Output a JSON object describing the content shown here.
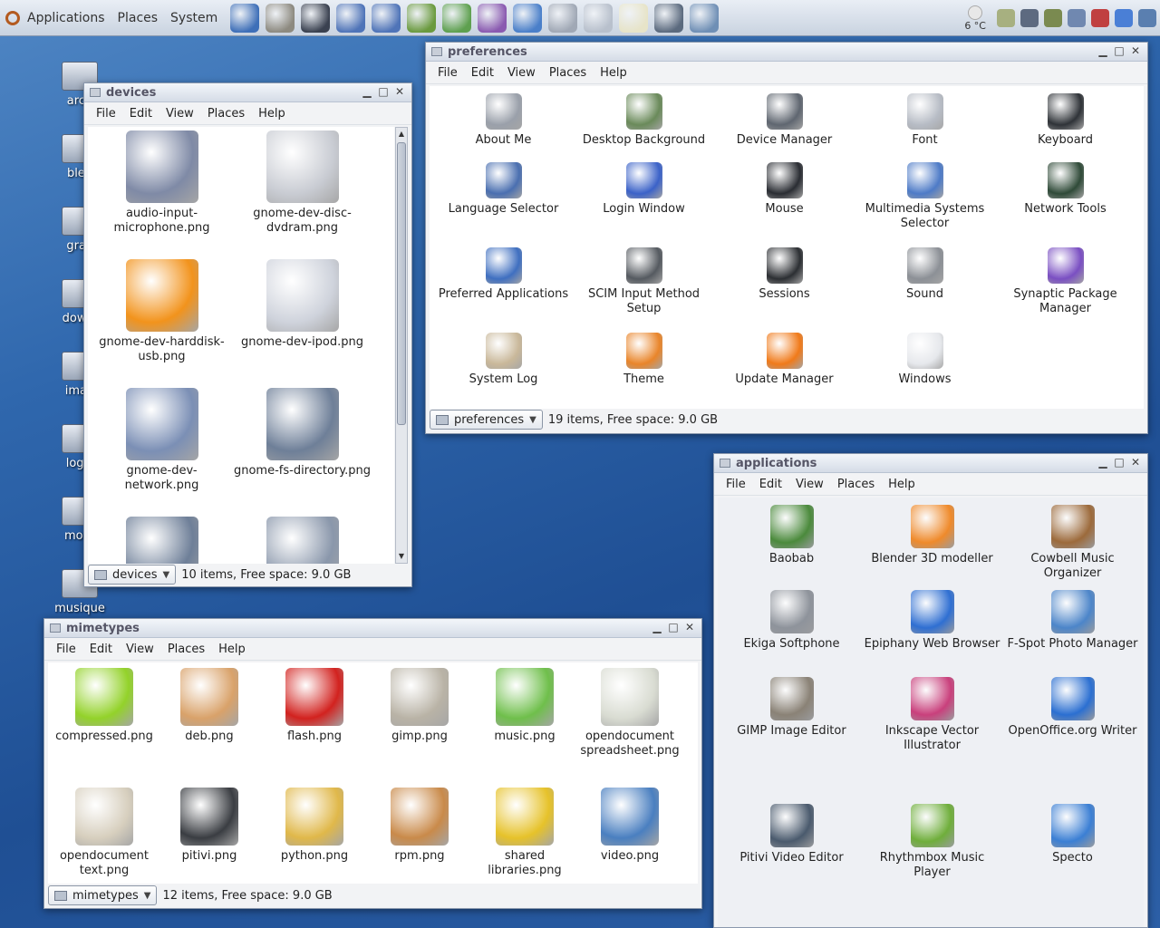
{
  "panel": {
    "menus": [
      "Applications",
      "Places",
      "System"
    ],
    "weather": "6 °C",
    "launchers": [
      "globe-icon",
      "gimp-icon",
      "terminal-icon",
      "compass-icon",
      "ekiga-icon",
      "person-icon",
      "music-icon",
      "flower-icon",
      "globe-icon",
      "x-icon",
      "drive-icon",
      "bulb-icon",
      "edit-icon",
      "photo-icon"
    ],
    "tray": [
      "cloud-icon",
      "music-note-icon",
      "person-icon",
      "network-icon",
      "record-icon",
      "mail-icon",
      "window-icon"
    ]
  },
  "desktop": {
    "icons": [
      "arch",
      "blen",
      "grav",
      "downl",
      "imag",
      "logic",
      "mont",
      "musique"
    ]
  },
  "windows": {
    "devices": {
      "title": "devices",
      "menu": [
        "File",
        "Edit",
        "View",
        "Places",
        "Help"
      ],
      "items": [
        {
          "label": "audio-input-microphone.png",
          "icon": "microphone-icon",
          "color": "#7f8aa6"
        },
        {
          "label": "gnome-dev-disc-dvdram.png",
          "icon": "dvd-icon",
          "color": "#c9ccd3"
        },
        {
          "label": "gnome-dev-harddisk-usb.png",
          "icon": "usb-drive-icon",
          "color": "#f2931c"
        },
        {
          "label": "gnome-dev-ipod.png",
          "icon": "ipod-icon",
          "color": "#cfd3dc"
        },
        {
          "label": "gnome-dev-network.png",
          "icon": "network-drive-icon",
          "color": "#7b8fb5"
        },
        {
          "label": "gnome-fs-directory.png",
          "icon": "folder-icon",
          "color": "#6e7f98"
        },
        {
          "label": "",
          "icon": "folder-open-icon",
          "color": "#6e7f98"
        },
        {
          "label": "",
          "icon": "folder-icon",
          "color": "#8a97ab"
        }
      ],
      "combo": "devices",
      "status": "10 items, Free space: 9.0 GB"
    },
    "preferences": {
      "title": "preferences",
      "menu": [
        "File",
        "Edit",
        "View",
        "Places",
        "Help"
      ],
      "items": [
        {
          "label": "About Me",
          "icon": "about-me-icon",
          "color": "#9aa0aa"
        },
        {
          "label": "Desktop Background",
          "icon": "desktop-background-icon",
          "color": "#6a8a5a"
        },
        {
          "label": "Device Manager",
          "icon": "device-manager-icon",
          "color": "#5f6670"
        },
        {
          "label": "Font",
          "icon": "font-icon",
          "color": "#b7bcc5"
        },
        {
          "label": "Keyboard",
          "icon": "keyboard-icon",
          "color": "#2f3338"
        },
        {
          "label": "Language Selector",
          "icon": "language-icon",
          "color": "#4a6fb0"
        },
        {
          "label": "Login Window",
          "icon": "login-icon",
          "color": "#3b62c8"
        },
        {
          "label": "Mouse",
          "icon": "mouse-icon",
          "color": "#2a2d33"
        },
        {
          "label": "Multimedia Systems Selector",
          "icon": "multimedia-icon",
          "color": "#4e7bc7"
        },
        {
          "label": "Network Tools",
          "icon": "network-tools-icon",
          "color": "#2f4a38"
        },
        {
          "label": "Preferred Applications",
          "icon": "preferred-apps-icon",
          "color": "#3f6fc0"
        },
        {
          "label": "SCIM Input Method Setup",
          "icon": "scim-icon",
          "color": "#555a60"
        },
        {
          "label": "Sessions",
          "icon": "sessions-icon",
          "color": "#2c2f33"
        },
        {
          "label": "Sound",
          "icon": "sound-icon",
          "color": "#8c9096"
        },
        {
          "label": "Synaptic Package Manager",
          "icon": "synaptic-icon",
          "color": "#7a4fc2"
        },
        {
          "label": "System Log",
          "icon": "system-log-icon",
          "color": "#c9b89a"
        },
        {
          "label": "Theme",
          "icon": "theme-icon",
          "color": "#e9852a"
        },
        {
          "label": "Update Manager",
          "icon": "update-icon",
          "color": "#f07a1a"
        },
        {
          "label": "Windows",
          "icon": "windows-icon",
          "color": "#e6e8ec"
        }
      ],
      "combo": "preferences",
      "status": "19 items, Free space: 9.0 GB"
    },
    "applications": {
      "title": "applications",
      "menu": [
        "File",
        "Edit",
        "View",
        "Places",
        "Help"
      ],
      "items": [
        {
          "label": "Baobab",
          "icon": "baobab-icon",
          "color": "#4b8a3c"
        },
        {
          "label": "Blender 3D modeller",
          "icon": "blender-icon",
          "color": "#ef8a2b"
        },
        {
          "label": "Cowbell Music Organizer",
          "icon": "cowbell-icon",
          "color": "#9c6a3b"
        },
        {
          "label": "Ekiga Softphone",
          "icon": "ekiga-icon",
          "color": "#8e939b"
        },
        {
          "label": "Epiphany Web Browser",
          "icon": "epiphany-icon",
          "color": "#2f6fd2"
        },
        {
          "label": "F-Spot Photo Manager",
          "icon": "fspot-icon",
          "color": "#4c85c9"
        },
        {
          "label": "GIMP Image Editor",
          "icon": "gimp-icon",
          "color": "#8a8276"
        },
        {
          "label": "Inkscape Vector Illustrator",
          "icon": "inkscape-icon",
          "color": "#c9407c"
        },
        {
          "label": "OpenOffice.org Writer",
          "icon": "writer-icon",
          "color": "#2b6fd1"
        },
        {
          "label": "Pitivi Video Editor",
          "icon": "pitivi-icon",
          "color": "#4a5a6d"
        },
        {
          "label": "Rhythmbox Music Player",
          "icon": "rhythmbox-icon",
          "color": "#6fae3b"
        },
        {
          "label": "Specto",
          "icon": "specto-icon",
          "color": "#3b7fd4"
        }
      ]
    },
    "mimetypes": {
      "title": "mimetypes",
      "menu": [
        "File",
        "Edit",
        "View",
        "Places",
        "Help"
      ],
      "items": [
        {
          "label": "compressed.png",
          "icon": "compressed-icon",
          "color": "#93d22a"
        },
        {
          "label": "deb.png",
          "icon": "deb-icon",
          "color": "#d9a26a"
        },
        {
          "label": "flash.png",
          "icon": "flash-icon",
          "color": "#d2221f"
        },
        {
          "label": "gimp.png",
          "icon": "gimp-file-icon",
          "color": "#b9b3a6"
        },
        {
          "label": "music.png",
          "icon": "ogg-icon",
          "color": "#6fbf4b"
        },
        {
          "label": "opendocument spreadsheet.png",
          "icon": "spreadsheet-icon",
          "color": "#d9dcd2"
        },
        {
          "label": "opendocument text.png",
          "icon": "text-doc-icon",
          "color": "#d7cfbe"
        },
        {
          "label": "pitivi.png",
          "icon": "pitivi-file-icon",
          "color": "#3a3d42"
        },
        {
          "label": "python.png",
          "icon": "python-icon",
          "color": "#e0b84a"
        },
        {
          "label": "rpm.png",
          "icon": "rpm-icon",
          "color": "#c98a4a"
        },
        {
          "label": "shared libraries.png",
          "icon": "shared-lib-icon",
          "color": "#e6c22a"
        },
        {
          "label": "video.png",
          "icon": "video-icon",
          "color": "#4a7fc0"
        }
      ],
      "combo": "mimetypes",
      "status": "12 items, Free space: 9.0 GB"
    }
  }
}
